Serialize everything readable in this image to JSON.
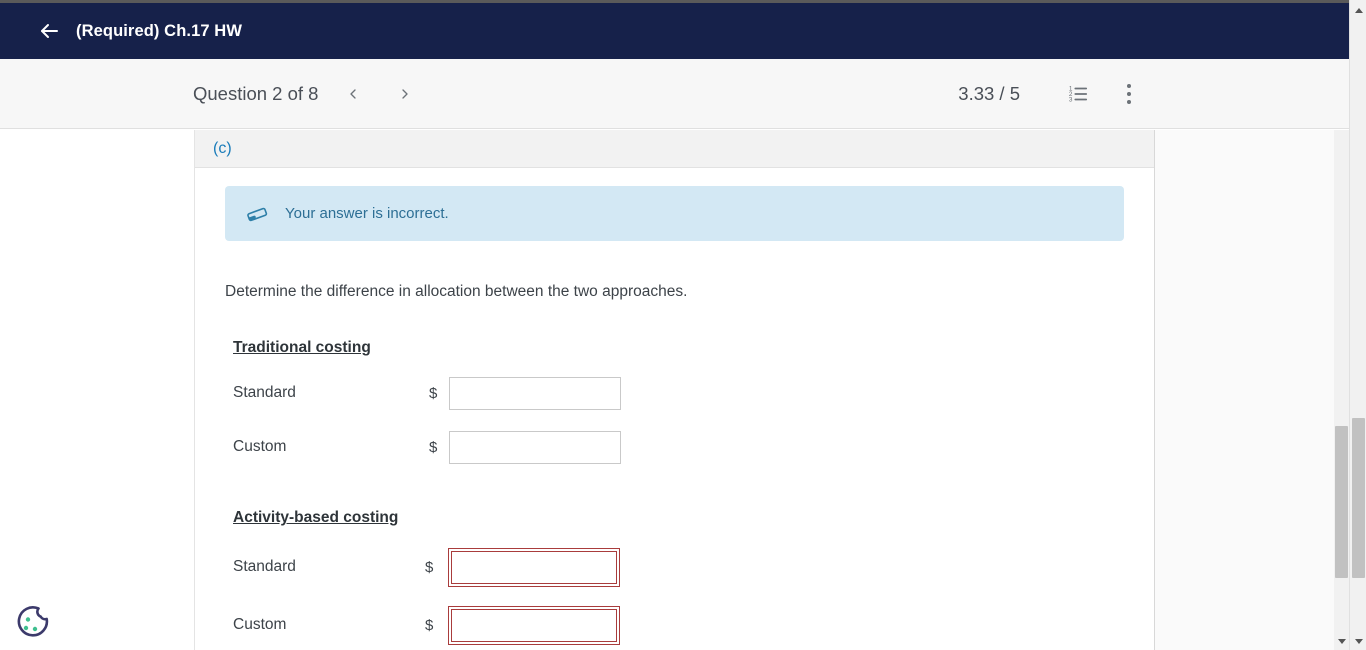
{
  "window": {
    "top_strip_color": "#5a5a5a"
  },
  "titlebar": {
    "background": "#16214a",
    "back_icon": "back-arrow-icon",
    "title": "(Required) Ch.17 HW"
  },
  "question_nav": {
    "label": "Question 2 of 8",
    "prev_icon": "chevron-left-icon",
    "next_icon": "chevron-right-icon",
    "score": "3.33 / 5",
    "list_icon": "numbered-list-icon",
    "menu_icon": "more-vertical-icon"
  },
  "panel": {
    "part_label": "(c)",
    "alert": {
      "icon": "eraser-icon",
      "text": "Your answer is incorrect.",
      "background": "#d3e8f4",
      "text_color": "#2d6f95"
    },
    "prompt": "Determine the difference in allocation between the two approaches.",
    "sections": [
      {
        "heading": "Traditional costing",
        "state": "normal",
        "rows": [
          {
            "label": "Standard",
            "currency": "$",
            "value": "",
            "placeholder": ""
          },
          {
            "label": "Custom",
            "currency": "$",
            "value": "",
            "placeholder": ""
          }
        ]
      },
      {
        "heading": "Activity-based costing",
        "state": "error",
        "error_color": "#a93c3c",
        "rows": [
          {
            "label": "Standard",
            "currency": "$",
            "value": "",
            "placeholder": ""
          },
          {
            "label": "Custom",
            "currency": "$",
            "value": "",
            "placeholder": ""
          }
        ]
      }
    ]
  },
  "cookie_widget": {
    "name": "cookie-consent-icon",
    "outline_color": "#3c3a6b",
    "chip_color": "#3fbf8f"
  },
  "scrollbars": {
    "outer_name": "browser-vertical-scrollbar",
    "inner_name": "content-vertical-scrollbar"
  }
}
